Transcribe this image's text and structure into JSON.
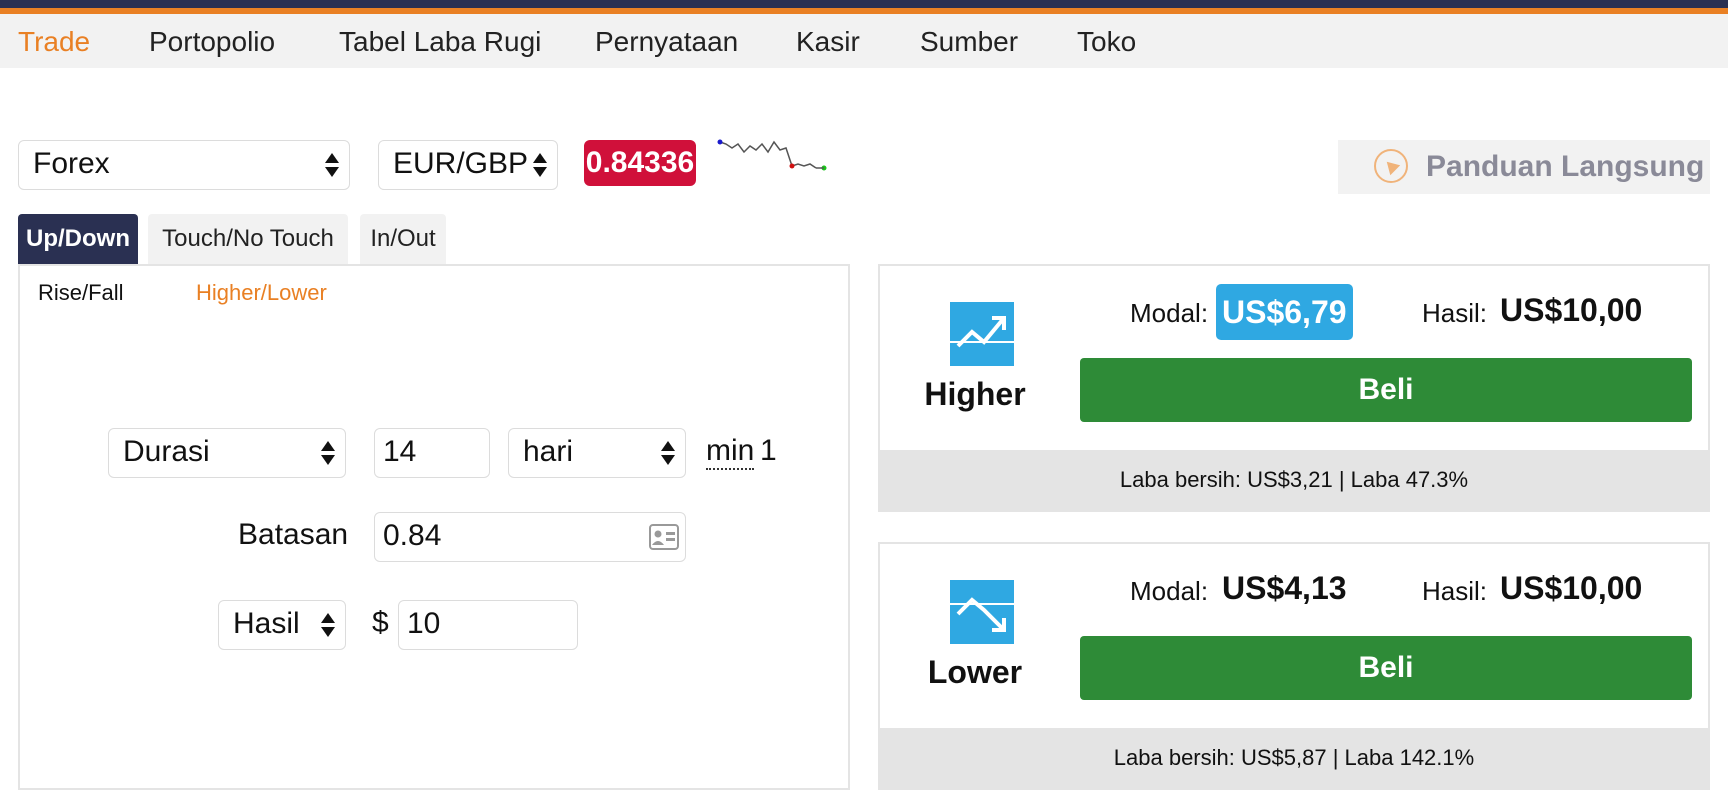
{
  "nav": {
    "items": [
      "Trade",
      "Portopolio",
      "Tabel Laba Rugi",
      "Pernyataan",
      "Kasir",
      "Sumber",
      "Toko"
    ],
    "active": "Trade"
  },
  "market": {
    "selected": "Forex"
  },
  "symbol": {
    "selected": "EUR/GBP"
  },
  "price": {
    "value": "0.84336"
  },
  "guide": {
    "label": "Panduan Langsung"
  },
  "tabs": [
    "Up/Down",
    "Touch/No Touch",
    "In/Out"
  ],
  "subtabs": [
    "Rise/Fall",
    "Higher/Lower"
  ],
  "form": {
    "duration_type": "Durasi",
    "duration_value": "14",
    "duration_unit": "hari",
    "min_label": "min",
    "min_value": "1",
    "barrier_label": "Batasan",
    "barrier_value": "0.84",
    "payout_type": "Hasil",
    "currency_symbol": "$",
    "amount": "10"
  },
  "contracts": [
    {
      "name": "Higher",
      "modal_label": "Modal:",
      "modal_value": "US$6,79",
      "hasil_label": "Hasil:",
      "hasil_value": "US$10,00",
      "buy_label": "Beli",
      "footer": "Laba bersih: US$3,21 | Laba 47.3%"
    },
    {
      "name": "Lower",
      "modal_label": "Modal:",
      "modal_value": "US$4,13",
      "hasil_label": "Hasil:",
      "hasil_value": "US$10,00",
      "buy_label": "Beli",
      "footer": "Laba bersih: US$5,87 | Laba 142.1%"
    }
  ],
  "colors": {
    "accent_orange": "#e98024",
    "navy": "#2a3052",
    "price_red": "#d0103a",
    "buy_green": "#2e8b37",
    "icon_blue": "#2fa8e2"
  }
}
